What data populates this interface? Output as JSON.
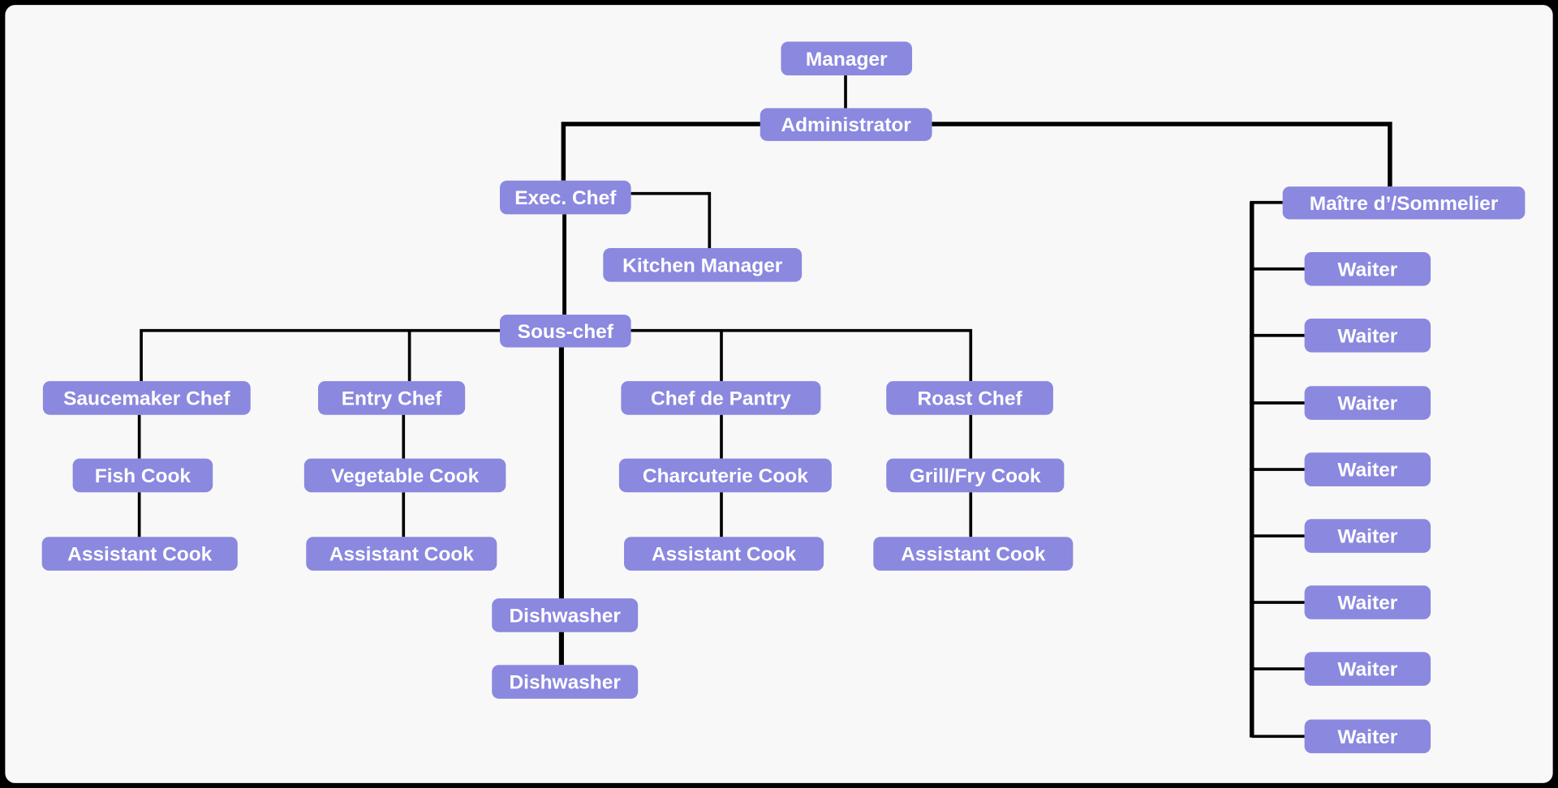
{
  "chart_colors": {
    "node_fill": "#8b88df",
    "node_text": "#ffffff",
    "connector": "#000000",
    "background": "#f8f8f8"
  },
  "org_chart": {
    "manager": "Manager",
    "administrator": "Administrator",
    "exec_chef": "Exec. Chef",
    "kitchen_manager": "Kitchen Manager",
    "sous_chef": "Sous-chef",
    "maitre": "Maître d’/Sommelier",
    "stations": [
      {
        "chef": "Saucemaker Chef",
        "cook": "Fish Cook",
        "assistant": "Assistant Cook"
      },
      {
        "chef": "Entry Chef",
        "cook": "Vegetable Cook",
        "assistant": "Assistant Cook"
      },
      {
        "chef": "Chef de Pantry",
        "cook": "Charcuterie Cook",
        "assistant": "Assistant Cook"
      },
      {
        "chef": "Roast Chef",
        "cook": "Grill/Fry Cook",
        "assistant": "Assistant Cook"
      }
    ],
    "dishwashers": [
      "Dishwasher",
      "Dishwasher"
    ],
    "waiters": [
      "Waiter",
      "Waiter",
      "Waiter",
      "Waiter",
      "Waiter",
      "Waiter",
      "Waiter",
      "Waiter"
    ]
  }
}
